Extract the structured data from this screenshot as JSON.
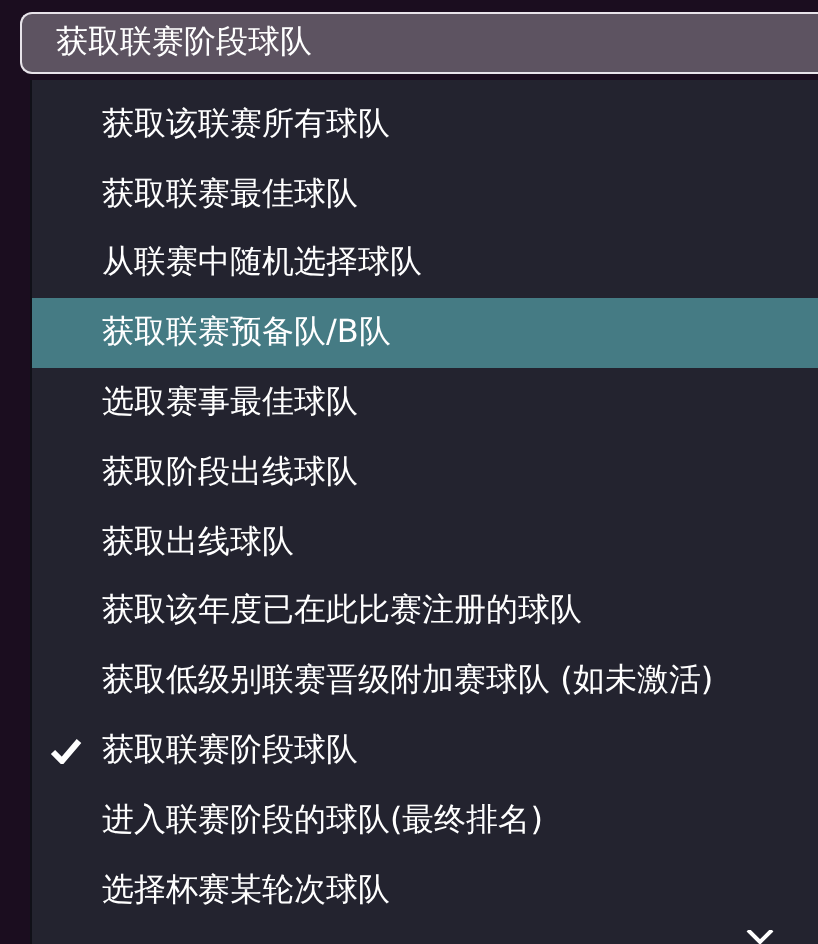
{
  "select": {
    "value": "获取联赛阶段球队"
  },
  "menu": {
    "items": [
      {
        "label": "获取该联赛所有球队",
        "selected": false,
        "checked": false
      },
      {
        "label": "获取联赛最佳球队",
        "selected": false,
        "checked": false
      },
      {
        "label": "从联赛中随机选择球队",
        "selected": false,
        "checked": false
      },
      {
        "label": "获取联赛预备队/B队",
        "selected": true,
        "checked": false
      },
      {
        "label": "选取赛事最佳球队",
        "selected": false,
        "checked": false
      },
      {
        "label": "获取阶段出线球队",
        "selected": false,
        "checked": false
      },
      {
        "label": "获取出线球队",
        "selected": false,
        "checked": false
      },
      {
        "label": "获取该年度已在此比赛注册的球队",
        "selected": false,
        "checked": false
      },
      {
        "label": "获取低级别联赛晋级附加赛球队 (如未激活)",
        "selected": false,
        "checked": false
      },
      {
        "label": "获取联赛阶段球队",
        "selected": false,
        "checked": true
      },
      {
        "label": "进入联赛阶段的球队(最终排名)",
        "selected": false,
        "checked": false
      },
      {
        "label": "选择杯赛某轮次球队",
        "selected": false,
        "checked": false
      }
    ]
  }
}
